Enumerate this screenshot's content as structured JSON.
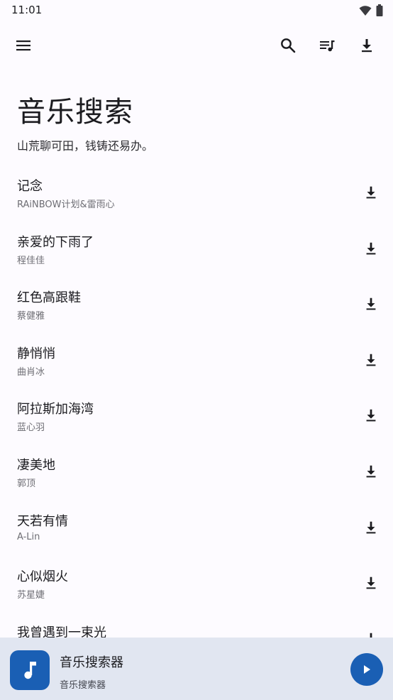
{
  "status": {
    "time": "11:01"
  },
  "header": {
    "title": "音乐搜索",
    "subtitle": "山荒聊可田，钱铸还易办。"
  },
  "songs": [
    {
      "name": "记念",
      "artist": "RAiNBOW计划&雷雨心"
    },
    {
      "name": "亲爱的下雨了",
      "artist": "程佳佳"
    },
    {
      "name": "红色高跟鞋",
      "artist": "蔡健雅"
    },
    {
      "name": "静悄悄",
      "artist": "曲肖冰"
    },
    {
      "name": "阿拉斯加海湾",
      "artist": "蓝心羽"
    },
    {
      "name": "凄美地",
      "artist": "郭顶"
    },
    {
      "name": "天若有情",
      "artist": "A-Lin"
    },
    {
      "name": "心似烟火",
      "artist": "苏星婕"
    },
    {
      "name": "我曾遇到一束光",
      "artist": ""
    }
  ],
  "player": {
    "title": "音乐搜索器",
    "subtitle": "音乐搜索器"
  },
  "colors": {
    "accent": "#1a5fb4",
    "player_bg": "#e1e6f1",
    "background": "#fdfbff"
  }
}
